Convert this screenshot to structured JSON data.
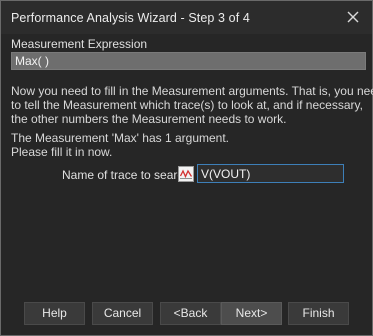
{
  "window": {
    "title": "Performance Analysis Wizard - Step 3 of 4",
    "close_icon": "close-icon"
  },
  "measurement": {
    "label": "Measurement Expression",
    "expression": "Max( )"
  },
  "instructions": {
    "line1": "Now you need to fill in the Measurement arguments.  That is, you need",
    "line2": "to tell the Measurement which trace(s) to look at, and if necessary,",
    "line3": "the other numbers the Measurement needs to work.",
    "line4": "The Measurement 'Max' has 1 argument.",
    "line5": "Please fill it in now."
  },
  "argument": {
    "label": "Name of trace to search",
    "value": "V(VOUT)",
    "picker_icon": "trace-picker-icon"
  },
  "buttons": {
    "help": "Help",
    "cancel": "Cancel",
    "back": "<Back",
    "next": "Next>",
    "finish": "Finish"
  }
}
